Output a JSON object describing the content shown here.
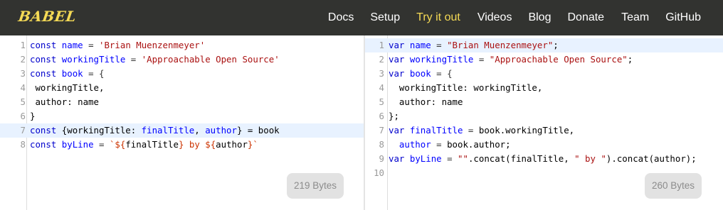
{
  "header": {
    "logo": "BABEL",
    "nav": [
      {
        "label": "Docs",
        "active": false
      },
      {
        "label": "Setup",
        "active": false
      },
      {
        "label": "Try it out",
        "active": true
      },
      {
        "label": "Videos",
        "active": false
      },
      {
        "label": "Blog",
        "active": false
      },
      {
        "label": "Donate",
        "active": false
      },
      {
        "label": "Team",
        "active": false
      },
      {
        "label": "GitHub",
        "active": false
      }
    ]
  },
  "input": {
    "size_label": "219 Bytes",
    "highlighted_line": 7,
    "lines": [
      [
        [
          "kw",
          "const"
        ],
        [
          "pl",
          " "
        ],
        [
          "var",
          "name"
        ],
        [
          "op",
          " = "
        ],
        [
          "str",
          "'Brian Muenzenmeyer'"
        ]
      ],
      [
        [
          "kw",
          "const"
        ],
        [
          "pl",
          " "
        ],
        [
          "var",
          "workingTitle"
        ],
        [
          "op",
          " = "
        ],
        [
          "str",
          "'Approachable Open Source'"
        ]
      ],
      [
        [
          "kw",
          "const"
        ],
        [
          "pl",
          " "
        ],
        [
          "var",
          "book"
        ],
        [
          "op",
          " = {"
        ]
      ],
      [
        [
          "pl",
          " workingTitle,"
        ]
      ],
      [
        [
          "pl",
          " author: name"
        ]
      ],
      [
        [
          "pl",
          "}"
        ]
      ],
      [
        [
          "kw",
          "const"
        ],
        [
          "pl",
          " {workingTitle: "
        ],
        [
          "var",
          "finalTitle"
        ],
        [
          "pl",
          ", "
        ],
        [
          "var",
          "author"
        ],
        [
          "pl",
          "} = book"
        ]
      ],
      [
        [
          "kw",
          "const"
        ],
        [
          "pl",
          " "
        ],
        [
          "var",
          "byLine"
        ],
        [
          "op",
          " = "
        ],
        [
          "tpl",
          "`${"
        ],
        [
          "pl",
          "finalTitle"
        ],
        [
          "tpl",
          "} by ${"
        ],
        [
          "pl",
          "author"
        ],
        [
          "tpl",
          "}`"
        ]
      ]
    ]
  },
  "output": {
    "size_label": "260 Bytes",
    "highlighted_line": 1,
    "lines": [
      [
        [
          "kw",
          "var"
        ],
        [
          "pl",
          " "
        ],
        [
          "var",
          "name"
        ],
        [
          "op",
          " = "
        ],
        [
          "str",
          "\"Brian Muenzenmeyer\""
        ],
        [
          "pl",
          ";"
        ]
      ],
      [
        [
          "kw",
          "var"
        ],
        [
          "pl",
          " "
        ],
        [
          "var",
          "workingTitle"
        ],
        [
          "op",
          " = "
        ],
        [
          "str",
          "\"Approachable Open Source\""
        ],
        [
          "pl",
          ";"
        ]
      ],
      [
        [
          "kw",
          "var"
        ],
        [
          "pl",
          " "
        ],
        [
          "var",
          "book"
        ],
        [
          "op",
          " = {"
        ]
      ],
      [
        [
          "pl",
          "  workingTitle: workingTitle,"
        ]
      ],
      [
        [
          "pl",
          "  author: name"
        ]
      ],
      [
        [
          "pl",
          "};"
        ]
      ],
      [
        [
          "kw",
          "var"
        ],
        [
          "pl",
          " "
        ],
        [
          "var",
          "finalTitle"
        ],
        [
          "op",
          " = "
        ],
        [
          "pl",
          "book.workingTitle,"
        ]
      ],
      [
        [
          "pl",
          "  "
        ],
        [
          "var",
          "author"
        ],
        [
          "op",
          " = "
        ],
        [
          "pl",
          "book.author;"
        ]
      ],
      [
        [
          "kw",
          "var"
        ],
        [
          "pl",
          " "
        ],
        [
          "var",
          "byLine"
        ],
        [
          "op",
          " = "
        ],
        [
          "str",
          "\"\""
        ],
        [
          "pl",
          ".concat(finalTitle, "
        ],
        [
          "str",
          "\" by \""
        ],
        [
          "pl",
          ").concat(author);"
        ]
      ],
      []
    ]
  }
}
